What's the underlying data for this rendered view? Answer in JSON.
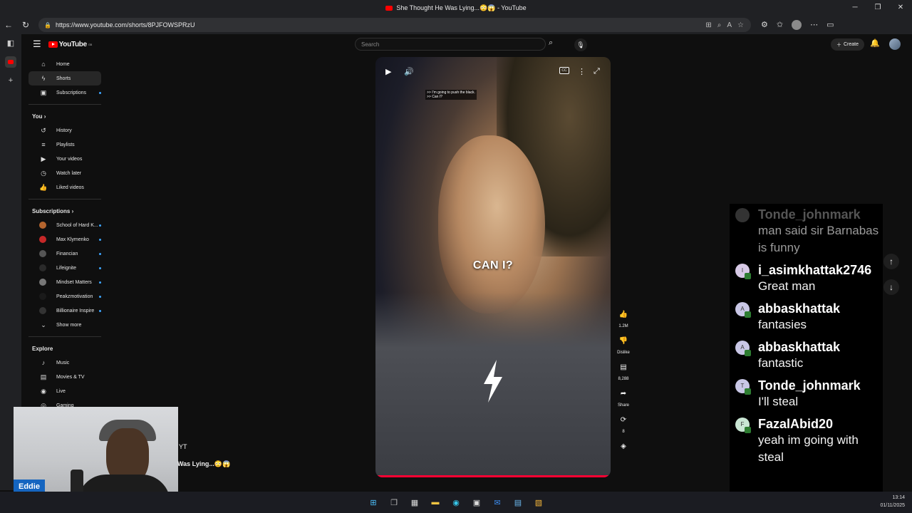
{
  "browser": {
    "tab_title": "She Thought He Was Lying...😳😱 - YouTube",
    "url": "https://www.youtube.com/shorts/8PJFOWSPRzU"
  },
  "youtube": {
    "logo_text": "YouTube",
    "logo_region": "GB",
    "search_placeholder": "Search",
    "create_label": "Create"
  },
  "sidebar": {
    "main": [
      {
        "label": "Home",
        "icon": "home-icon"
      },
      {
        "label": "Shorts",
        "icon": "shorts-icon"
      },
      {
        "label": "Subscriptions",
        "icon": "subscriptions-icon"
      }
    ],
    "you_heading": "You",
    "you": [
      {
        "label": "History",
        "icon": "history-icon"
      },
      {
        "label": "Playlists",
        "icon": "playlists-icon"
      },
      {
        "label": "Your videos",
        "icon": "your-videos-icon"
      },
      {
        "label": "Watch later",
        "icon": "watch-later-icon"
      },
      {
        "label": "Liked videos",
        "icon": "liked-videos-icon"
      }
    ],
    "subs_heading": "Subscriptions",
    "subscriptions": [
      {
        "label": "School of Hard K...",
        "color": "#b5652e"
      },
      {
        "label": "Max Klymenko",
        "color": "#c62828"
      },
      {
        "label": "Financian",
        "color": "#555555"
      },
      {
        "label": "Lifeignite",
        "color": "#2a2a2a"
      },
      {
        "label": "Mindset Matters",
        "color": "#777777"
      },
      {
        "label": "Peakzmotivation",
        "color": "#1a1a1a"
      },
      {
        "label": "Billionaire Inspire",
        "color": "#333333"
      }
    ],
    "show_more": "Show more",
    "explore_heading": "Explore",
    "explore": [
      {
        "label": "Music",
        "icon": "music-icon"
      },
      {
        "label": "Movies & TV",
        "icon": "movies-icon"
      },
      {
        "label": "Live",
        "icon": "live-icon"
      },
      {
        "label": "Gaming",
        "icon": "gaming-icon"
      }
    ]
  },
  "video": {
    "subtitle_line1": ">> I'm going to push the black.",
    "subtitle_line2": ">> Can I?",
    "caption": "CAN I?"
  },
  "actions": {
    "likes": "1.2M",
    "dislike": "Dislike",
    "comments": "8,288",
    "share": "Share",
    "remix": "8"
  },
  "chat": [
    {
      "name": "Tonde_johnmark",
      "text": "man said sir Barnabas is funny",
      "initial": "",
      "color": "#333333",
      "faded": true
    },
    {
      "name": "i_asimkhattak2746",
      "text": "Great man",
      "initial": "I",
      "color": "#d7c9e6",
      "faded": false
    },
    {
      "name": "abbaskhattak",
      "text": "fantasies",
      "initial": "A",
      "color": "#c9c7e6",
      "faded": false
    },
    {
      "name": "abbaskhattak",
      "text": "fantastic",
      "initial": "A",
      "color": "#c9c7e6",
      "faded": false
    },
    {
      "name": "Tonde_johnmark",
      "text": "I'll steal",
      "initial": "T",
      "color": "#c9c7e6",
      "faded": false
    },
    {
      "name": "FazalAbid20",
      "text": "yeah im going with steal",
      "initial": "F",
      "color": "#c9e6d4",
      "faded": false
    }
  ],
  "overlay": {
    "streamer_name": "Eddie",
    "partial_channel": "YT",
    "partial_title": "Was Lying...😳😱"
  },
  "system": {
    "time": "13:14",
    "date": "01/11/2025"
  }
}
